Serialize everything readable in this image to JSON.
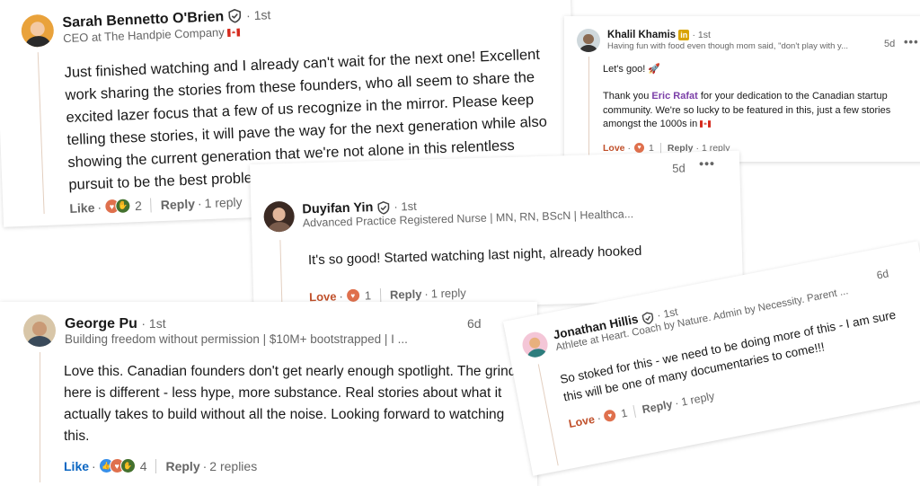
{
  "sarah": {
    "name": "Sarah Bennetto O'Brien",
    "degree": "· 1st",
    "headline": "CEO at The Handpie Company",
    "body": "Just finished watching and I already can't wait for the next one! Excellent work sharing the stories from these founders, who all seem to share the excited lazer focus that a few of us recognize in the mirror. Please keep telling these stories, it will pave the way for the next generation while also showing the current generation that we're not alone in this relentless pursuit to be the best problem solvers that we can be.",
    "like_label": "Like",
    "reaction_count": "2",
    "reply_label": "Reply",
    "replies": "1 reply"
  },
  "khalil": {
    "name": "Khalil Khamis",
    "degree": "· 1st",
    "headline": "Having fun with food even though mom said, \"don't play with y...",
    "time": "5d",
    "line1": "Let's goo! 🚀",
    "thank_pre": "Thank you ",
    "mention": "Eric Rafat",
    "thank_post": " for your dedication to the Canadian startup community. We're so lucky to be featured in this, just a few stories amongst the 1000s in",
    "love_label": "Love",
    "reaction_count": "1",
    "reply_label": "Reply",
    "replies": "1 reply"
  },
  "duyifan": {
    "name": "Duyifan Yin",
    "degree": "· 1st",
    "headline": "Advanced Practice Registered Nurse | MN, RN, BScN | Healthca...",
    "time": "5d",
    "body": "It's so good! Started watching last night, already hooked",
    "love_label": "Love",
    "reaction_count": "1",
    "reply_label": "Reply",
    "replies": "1 reply"
  },
  "george": {
    "name": "George Pu",
    "degree": "· 1st",
    "headline": "Building freedom without permission | $10M+ bootstrapped | I ...",
    "time": "6d",
    "body": "Love this. Canadian founders don't get nearly enough spotlight. The grind here is different - less hype, more substance. Real stories about what it actually takes to build without all the noise. Looking forward to watching this.",
    "like_label": "Like",
    "reaction_count": "4",
    "reply_label": "Reply",
    "replies": "2 replies"
  },
  "jonathan": {
    "name": "Jonathan Hillis",
    "degree": "· 1st",
    "headline": "Athlete at Heart. Coach by Nature. Admin by Necessity. Parent ...",
    "time": "6d",
    "body": "So stoked for this - we need to be doing more of this - I am sure this will be one of many documentaries to come!!!",
    "love_label": "Love",
    "reaction_count": "1",
    "reply_label": "Reply",
    "replies": "1 reply"
  },
  "colors": {
    "like_blue": "#0a66c2",
    "love_red": "#c0502b",
    "celebrate_green": "#44712e",
    "thread_line": "#e3cfc0"
  },
  "icons": [
    "verified-shield-icon",
    "linkedin-in-icon",
    "canada-flag-icon",
    "heart-reaction-icon",
    "clap-reaction-icon",
    "thumbs-up-reaction-icon",
    "more-dots-icon"
  ]
}
